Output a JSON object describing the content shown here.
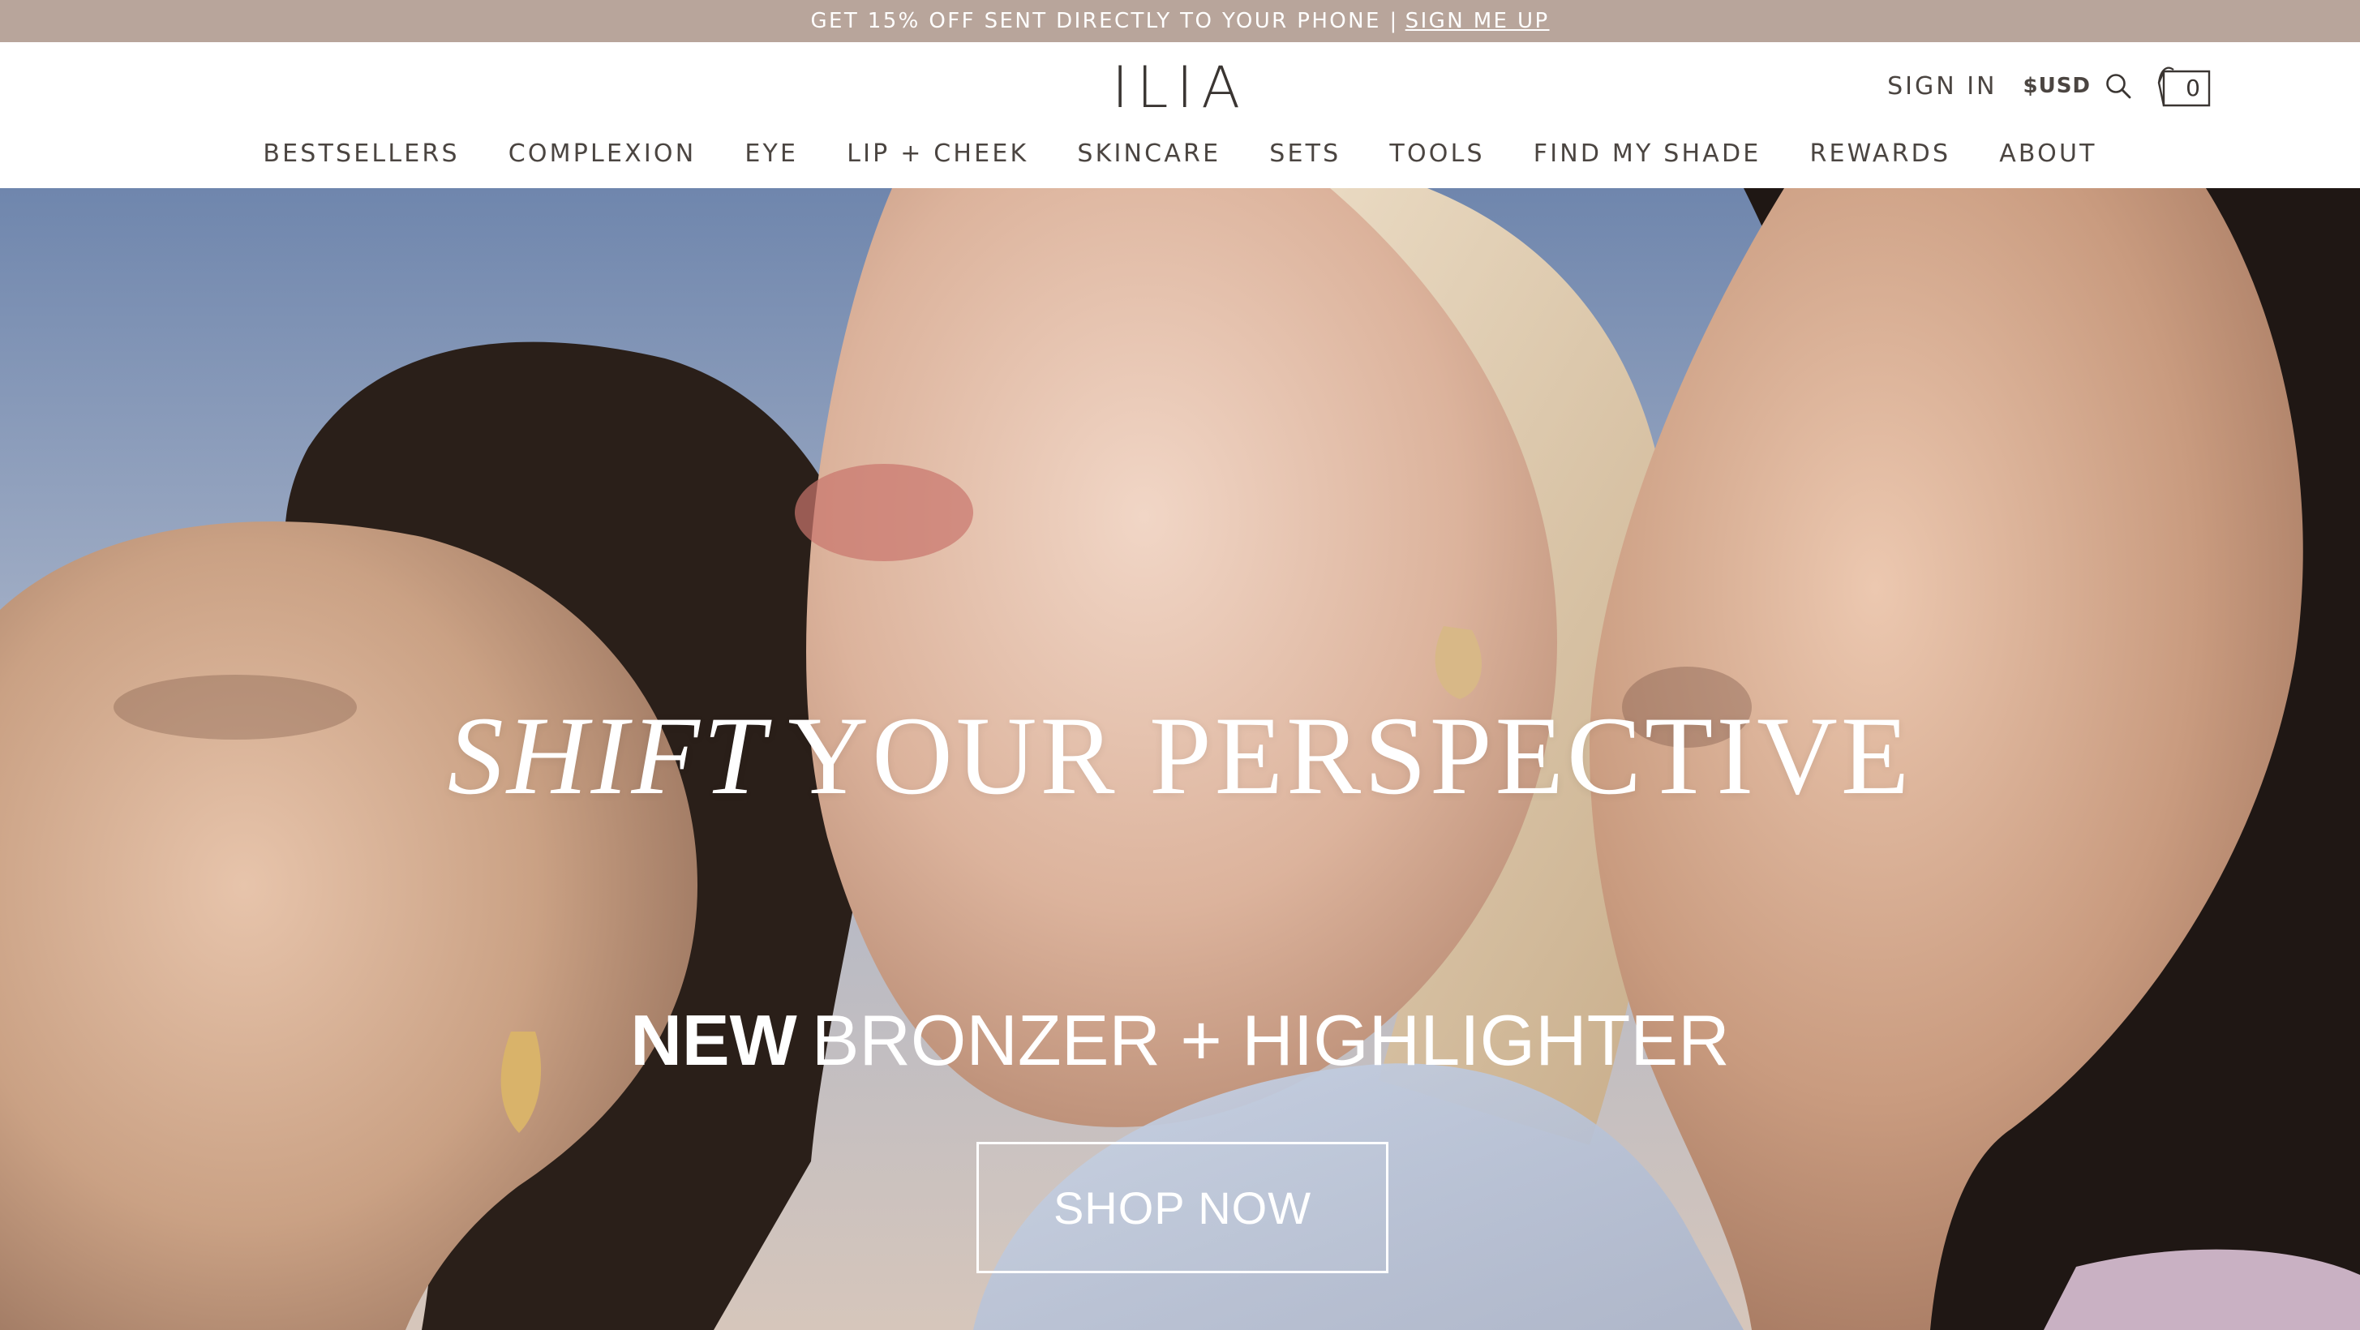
{
  "promo": {
    "text": "GET 15% OFF SENT DIRECTLY TO YOUR PHONE |",
    "link": "SIGN ME UP"
  },
  "header": {
    "logo": "ILIA",
    "sign_in": "SIGN IN",
    "currency": "$USD",
    "cart_count": "0"
  },
  "nav": {
    "items": [
      {
        "label": "BESTSELLERS"
      },
      {
        "label": "COMPLEXION"
      },
      {
        "label": "EYE"
      },
      {
        "label": "LIP + CHEEK"
      },
      {
        "label": "SKINCARE"
      },
      {
        "label": "SETS"
      },
      {
        "label": "TOOLS"
      },
      {
        "label": "FIND MY SHADE"
      },
      {
        "label": "REWARDS"
      },
      {
        "label": "ABOUT"
      }
    ]
  },
  "hero": {
    "headline_italic": "SHIFT",
    "headline_rest": "YOUR PERSPECTIVE",
    "subhead_bold": "NEW",
    "subhead_rest": "BRONZER + HIGHLIGHTER",
    "cta": "SHOP NOW"
  },
  "colors": {
    "promo_bg": "#b8a59b",
    "nav_text": "#4b4541",
    "hero_text": "#ffffff"
  }
}
